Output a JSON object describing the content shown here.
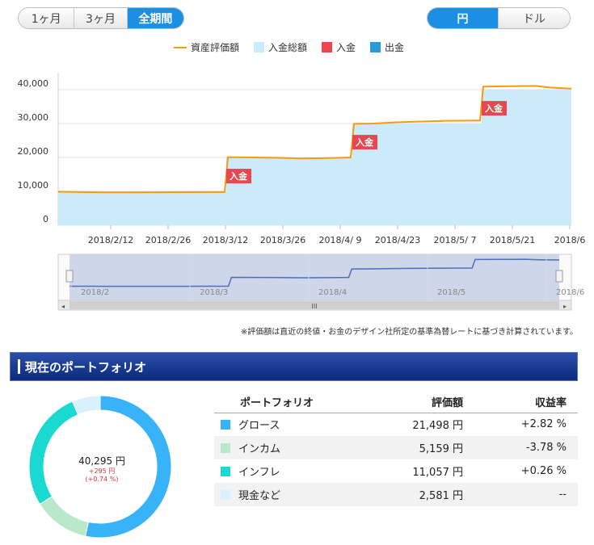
{
  "period_tabs": [
    {
      "label": "1ヶ月",
      "active": false
    },
    {
      "label": "3ヶ月",
      "active": false
    },
    {
      "label": "全期間",
      "active": true
    }
  ],
  "currency_tabs": [
    {
      "label": "円",
      "active": true
    },
    {
      "label": "ドル",
      "active": false
    }
  ],
  "legend": [
    {
      "label": "資産評価額",
      "color": "#f39c12",
      "kind": "line"
    },
    {
      "label": "入金総額",
      "color": "#cbeafa",
      "kind": "box"
    },
    {
      "label": "入金",
      "color": "#e8474f",
      "kind": "box"
    },
    {
      "label": "出金",
      "color": "#2b9bd6",
      "kind": "box"
    }
  ],
  "chart_data": {
    "type": "area",
    "y_ticks": [
      "40,000",
      "30,000",
      "20,000",
      "10,000",
      "0"
    ],
    "ylim": [
      0,
      45000
    ],
    "x_ticks": [
      "2018/2/12",
      "2018/2/26",
      "2018/3/12",
      "2018/3/26",
      "2018/4/ 9",
      "2018/4/23",
      "2018/5/ 7",
      "2018/5/21",
      "2018/6"
    ],
    "series": [
      {
        "name": "資産評価額",
        "color": "#f39c12",
        "values": [
          [
            0,
            9900
          ],
          [
            30,
            9800
          ],
          [
            60,
            9700
          ],
          [
            100,
            9700
          ],
          [
            140,
            9750
          ],
          [
            180,
            9800
          ],
          [
            206,
            9800
          ],
          [
            210,
            20100
          ],
          [
            240,
            20000
          ],
          [
            270,
            19900
          ],
          [
            300,
            19700
          ],
          [
            330,
            19800
          ],
          [
            362,
            20000
          ],
          [
            366,
            29900
          ],
          [
            390,
            30000
          ],
          [
            420,
            30400
          ],
          [
            450,
            30600
          ],
          [
            480,
            30800
          ],
          [
            522,
            30900
          ],
          [
            526,
            40900
          ],
          [
            560,
            41000
          ],
          [
            590,
            41100
          ],
          [
            610,
            40600
          ],
          [
            635,
            40300
          ]
        ]
      },
      {
        "name": "入金総額",
        "color": "#cbeafa",
        "values": [
          [
            0,
            10000
          ],
          [
            208,
            10000
          ],
          [
            208,
            20000
          ],
          [
            364,
            20000
          ],
          [
            364,
            30000
          ],
          [
            524,
            30000
          ],
          [
            524,
            40000
          ],
          [
            635,
            40000
          ]
        ]
      }
    ],
    "markers": [
      {
        "label": "入金",
        "x": 208,
        "y": 14500
      },
      {
        "label": "入金",
        "x": 364,
        "y": 24500
      },
      {
        "label": "入金",
        "x": 524,
        "y": 34500
      }
    ]
  },
  "navigator": {
    "labels": [
      "2018/2",
      "2018/3",
      "2018/4",
      "2018/5",
      "2018/6"
    ],
    "scroll_label": "III"
  },
  "note": "※評価額は直近の終値・お金のデザイン社所定の基準為替レートに基づき計算されています。",
  "section_title": "現在のポートフォリオ",
  "donut": {
    "total": "40,295 円",
    "delta_yen": "+295 円",
    "delta_pct": "(+0.74 %)",
    "slices": [
      {
        "name": "グロース",
        "value": 21498,
        "color": "#38b3fa"
      },
      {
        "name": "インカム",
        "value": 5159,
        "color": "#b9e8cb"
      },
      {
        "name": "インフレ",
        "value": 11057,
        "color": "#19d9d0"
      },
      {
        "name": "現金など",
        "value": 2581,
        "color": "#d8f1fc"
      }
    ]
  },
  "portfolio_table": {
    "headers": [
      "ポートフォリオ",
      "評価額",
      "収益率"
    ],
    "rows": [
      {
        "name": "グロース",
        "value": "21,498 円",
        "return": "+2.82 %",
        "color": "#38b3fa",
        "sign": "pos"
      },
      {
        "name": "インカム",
        "value": "5,159 円",
        "return": "-3.78 %",
        "color": "#b9e8cb",
        "sign": "neg"
      },
      {
        "name": "インフレ",
        "value": "11,057 円",
        "return": "+0.26 %",
        "color": "#19d9d0",
        "sign": "pos"
      },
      {
        "name": "現金など",
        "value": "2,581 円",
        "return": "--",
        "color": "#d8f1fc",
        "sign": "none"
      }
    ]
  }
}
